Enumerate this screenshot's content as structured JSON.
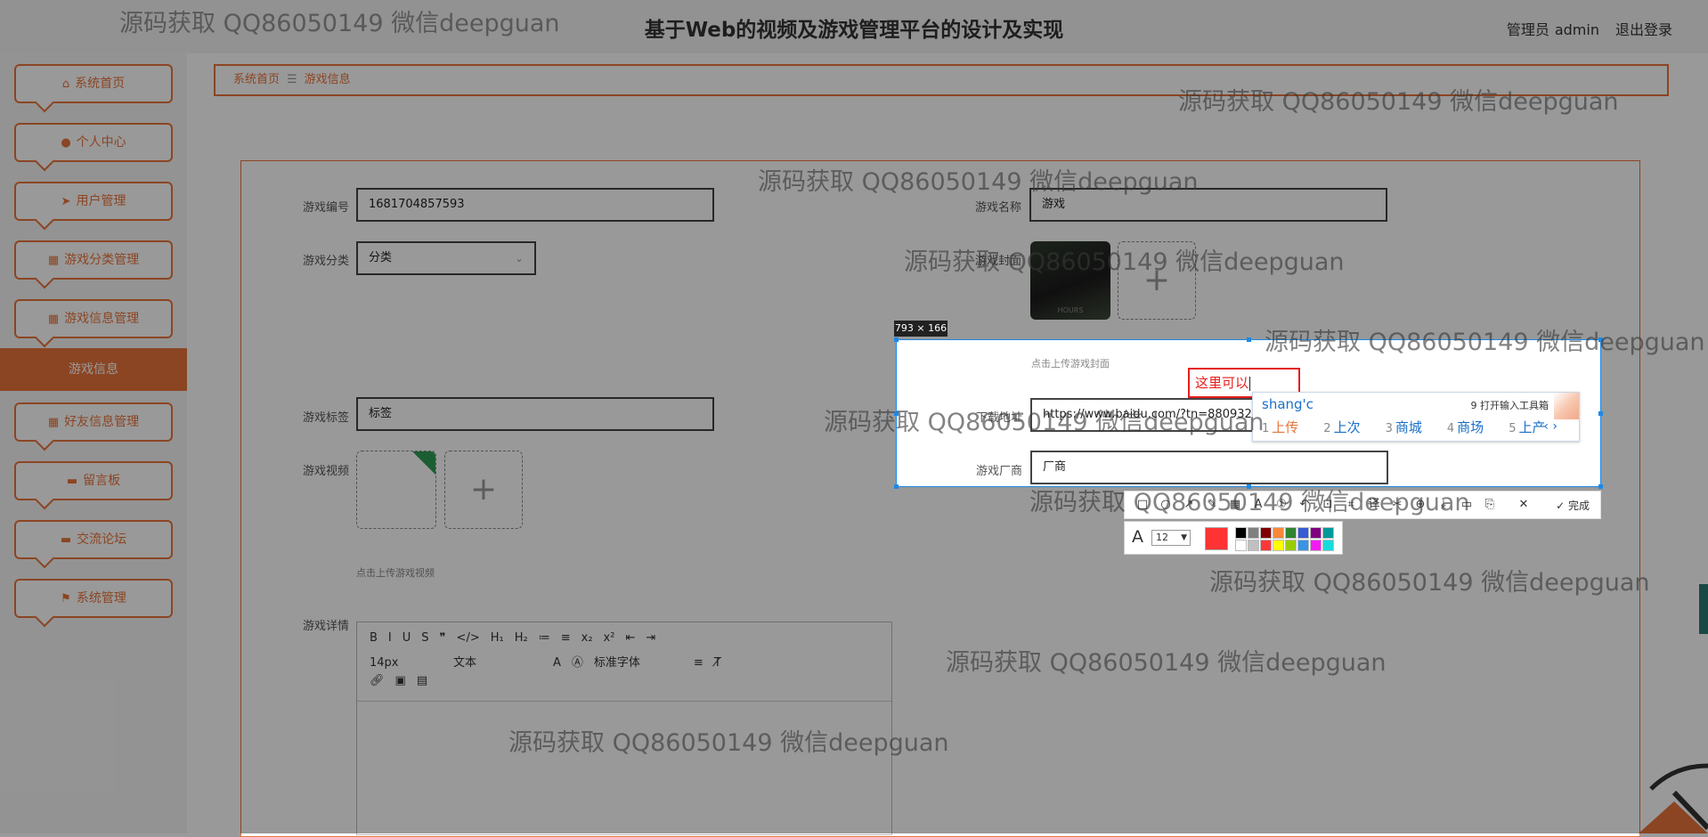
{
  "header": {
    "title": "基于Web的视频及游戏管理平台的设计及实现",
    "user_role": "管理员",
    "user_name": "admin",
    "logout": "退出登录"
  },
  "sidebar": {
    "items": [
      {
        "label": "系统首页",
        "icon": "home-icon"
      },
      {
        "label": "个人中心",
        "icon": "user-icon"
      },
      {
        "label": "用户管理",
        "icon": "send-icon"
      },
      {
        "label": "游戏分类管理",
        "icon": "grid-icon"
      },
      {
        "label": "游戏信息管理",
        "icon": "grid-icon"
      },
      {
        "label": "好友信息管理",
        "icon": "grid-icon"
      },
      {
        "label": "留言板",
        "icon": "monitor-icon"
      },
      {
        "label": "交流论坛",
        "icon": "monitor-icon"
      },
      {
        "label": "系统管理",
        "icon": "flag-icon"
      }
    ],
    "active_sub": "游戏信息"
  },
  "breadcrumb": {
    "home": "系统首页",
    "separator": "☰",
    "current": "游戏信息"
  },
  "form": {
    "game_no_label": "游戏编号",
    "game_no_value": "1681704857593",
    "game_name_label": "游戏名称",
    "game_name_value": "游戏",
    "category_label": "游戏分类",
    "category_value": "分类",
    "cover_label": "游戏封面",
    "cover_hint": "点击上传游戏封面",
    "thumb_text": "HOURS",
    "tags_label": "游戏标签",
    "tags_value": "标签",
    "download_label": "下载地址",
    "download_value": "https://www.baidu.com/?tn=88093251",
    "video_label": "游戏视频",
    "video_hint": "点击上传游戏视频",
    "vendor_label": "游戏厂商",
    "vendor_value": "厂商",
    "details_label": "游戏详情"
  },
  "editor": {
    "row1": [
      "B",
      "I",
      "U",
      "S",
      "❞",
      "</>",
      "H₁",
      "H₂",
      "≔",
      "≡",
      "x₂",
      "x²",
      "⇤",
      "⇥"
    ],
    "font_size": "14px",
    "block_type": "文本",
    "font_family": "标准字体",
    "row3_icons": [
      "link-icon",
      "image-icon",
      "video-icon"
    ]
  },
  "capture": {
    "size_label": "793 × 166",
    "annotation_text": "这里可以",
    "toolbar_done": "完成",
    "font_size": "12",
    "current_color": "#ff3333",
    "palette": [
      "#000000",
      "#808080",
      "#800000",
      "#f7883a",
      "#308430",
      "#385ad3",
      "#800080",
      "#009999",
      "#ffffff",
      "#c0c0c0",
      "#fb3838",
      "#ffff00",
      "#99cc00",
      "#3894e4",
      "#f31bf3",
      "#16dcdc"
    ]
  },
  "ime": {
    "composition": "shang'c",
    "toolbox": "9 打开输入工具箱",
    "candidates": [
      {
        "n": "1",
        "t": "上传"
      },
      {
        "n": "2",
        "t": "上次"
      },
      {
        "n": "3",
        "t": "商城"
      },
      {
        "n": "4",
        "t": "商场"
      },
      {
        "n": "5",
        "t": "上产"
      }
    ]
  },
  "watermark": "源码获取 QQ86050149 微信deepguan"
}
